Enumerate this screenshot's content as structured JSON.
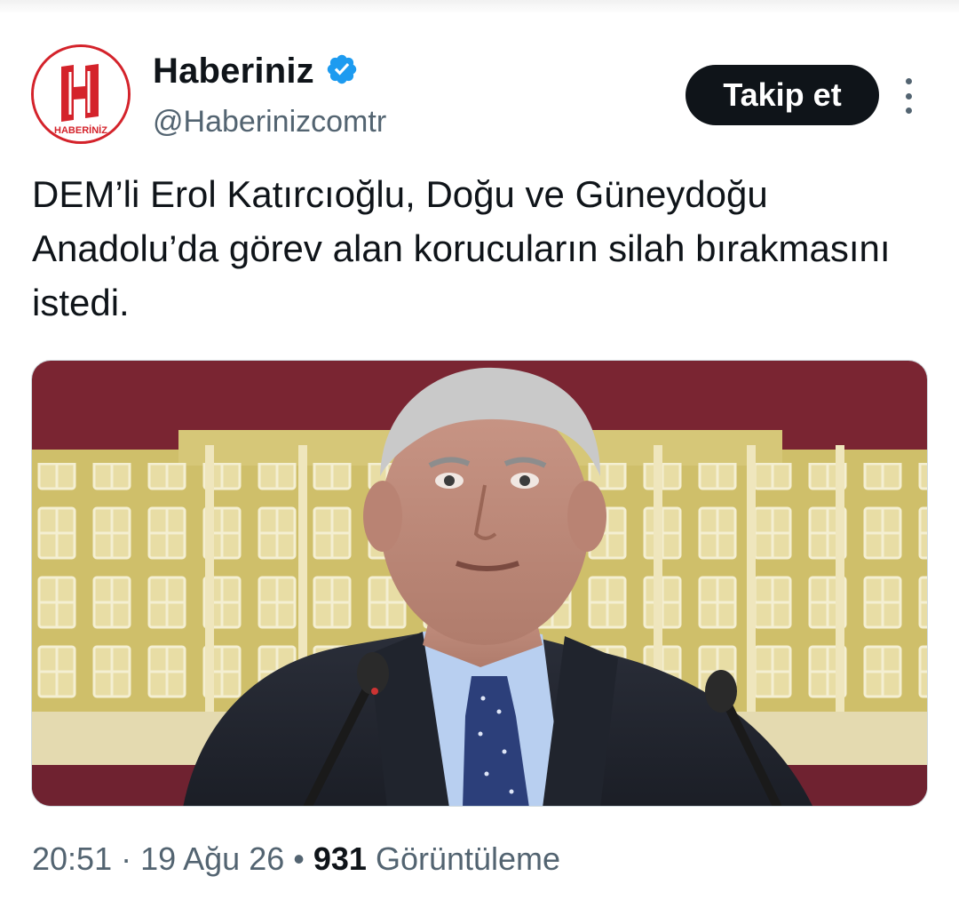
{
  "account": {
    "logo_text": "HABERİNİZ",
    "name": "Haberiniz",
    "verified_icon": "verified-badge-icon",
    "handle": "@Haberinizcomtr"
  },
  "actions": {
    "follow_label": "Takip et",
    "more_icon": "more-vertical-icon"
  },
  "tweet": {
    "text": "DEM’li Erol Katırcıoğlu, Doğu ve Güneydoğu Anadolu’da görev alan korucuların silah bırakmasını istedi."
  },
  "meta": {
    "time": "20:51",
    "date": "19 Ağu 26",
    "views_count": "931",
    "views_label": "Görüntüleme",
    "sep1": "·",
    "sep2": "•"
  },
  "colors": {
    "text": "#0f1419",
    "secondary": "#536471",
    "verified": "#1d9bf0",
    "logo_red": "#d4232b",
    "backdrop_maroon": "#7a2532",
    "backdrop_gold": "#cfbf6a"
  }
}
